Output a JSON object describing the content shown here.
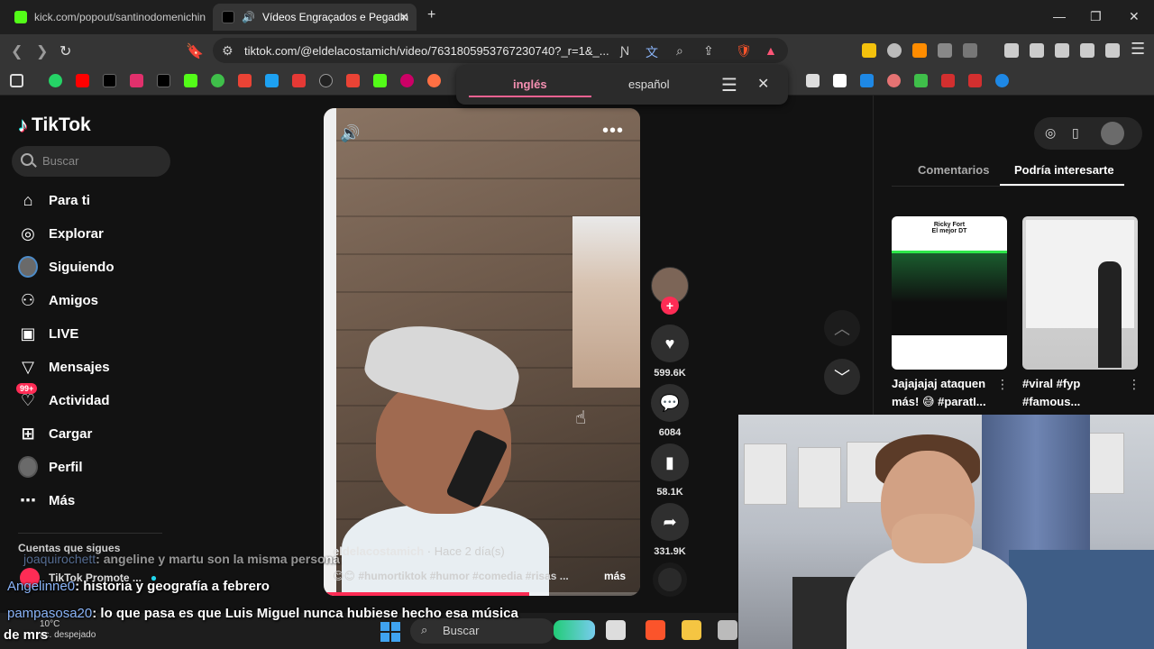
{
  "browser": {
    "tabs": [
      {
        "title": "kick.com/popout/santinodomenichin",
        "active": false
      },
      {
        "title": "Vídeos Engraçados e Pegadin",
        "active": true
      }
    ],
    "new_tab_symbol": "+",
    "url": "tiktok.com/@eldelacostamich/video/7631805953767230740?_r=1&_...",
    "window_controls": [
      "minimize",
      "maximize",
      "close"
    ]
  },
  "translate_popup": {
    "source_language": "inglés",
    "target_language": "español"
  },
  "tiktok": {
    "logo_text": "TikTok",
    "search_placeholder": "Buscar",
    "nav": [
      {
        "label": "Para ti",
        "icon": "home-icon"
      },
      {
        "label": "Explorar",
        "icon": "compass-icon"
      },
      {
        "label": "Siguiendo",
        "icon": "avatar-icon"
      },
      {
        "label": "Amigos",
        "icon": "friends-icon"
      },
      {
        "label": "LIVE",
        "icon": "live-icon"
      },
      {
        "label": "Mensajes",
        "icon": "send-icon"
      },
      {
        "label": "Actividad",
        "icon": "bell-icon",
        "badge": "99+"
      },
      {
        "label": "Cargar",
        "icon": "plus-square-icon"
      },
      {
        "label": "Perfil",
        "icon": "profile-avatar-icon"
      },
      {
        "label": "Más",
        "icon": "ellipsis-icon"
      }
    ],
    "following_title": "Cuentas que sigues",
    "following_items": [
      {
        "name": "TikTok Promote ..."
      }
    ],
    "video": {
      "author": "eldelacostamich",
      "posted": " · Hace 2 día(s)",
      "description": "😊😊 #humortiktok #humor #comedia #risas ...",
      "more_label": "más",
      "progress": 0.65
    },
    "actions": {
      "likes": "599.6K",
      "comments": "6084",
      "saves": "58.1K",
      "shares": "331.9K"
    },
    "right_panel": {
      "tabs": [
        "Comentarios",
        "Podría interesarte"
      ],
      "active_tab": "Podría interesarte",
      "thumbs": [
        {
          "caption": "Ricky Fort\nEl mejor DT",
          "title": "Jajajajaj ataquen más! 😅 #paratI..."
        },
        {
          "caption": "",
          "title": "#viral #fyp #famous..."
        }
      ]
    }
  },
  "chat": [
    {
      "user": "joaquirochett",
      "message": ": angeline y martu son la misma persona",
      "faded": true
    },
    {
      "user": "Angelinne0",
      "message": ": historia y geografía a febrero",
      "faded": false
    },
    {
      "user": "pampasosa20",
      "message": ": lo que pasa es que Luis Miguel nunca hubiese hecho esa música",
      "faded": false
    },
    {
      "user": "",
      "message": "de mrs",
      "faded": false
    }
  ],
  "taskbar": {
    "weather_temp": "10°C",
    "weather_desc": "ac. despejado",
    "search_placeholder": "Buscar"
  },
  "colors": {
    "tiktok_red": "#fe2c55",
    "tiktok_cyan": "#25f4ee",
    "chat_user": "#8ab4f8",
    "translate_accent": "#f06292"
  }
}
